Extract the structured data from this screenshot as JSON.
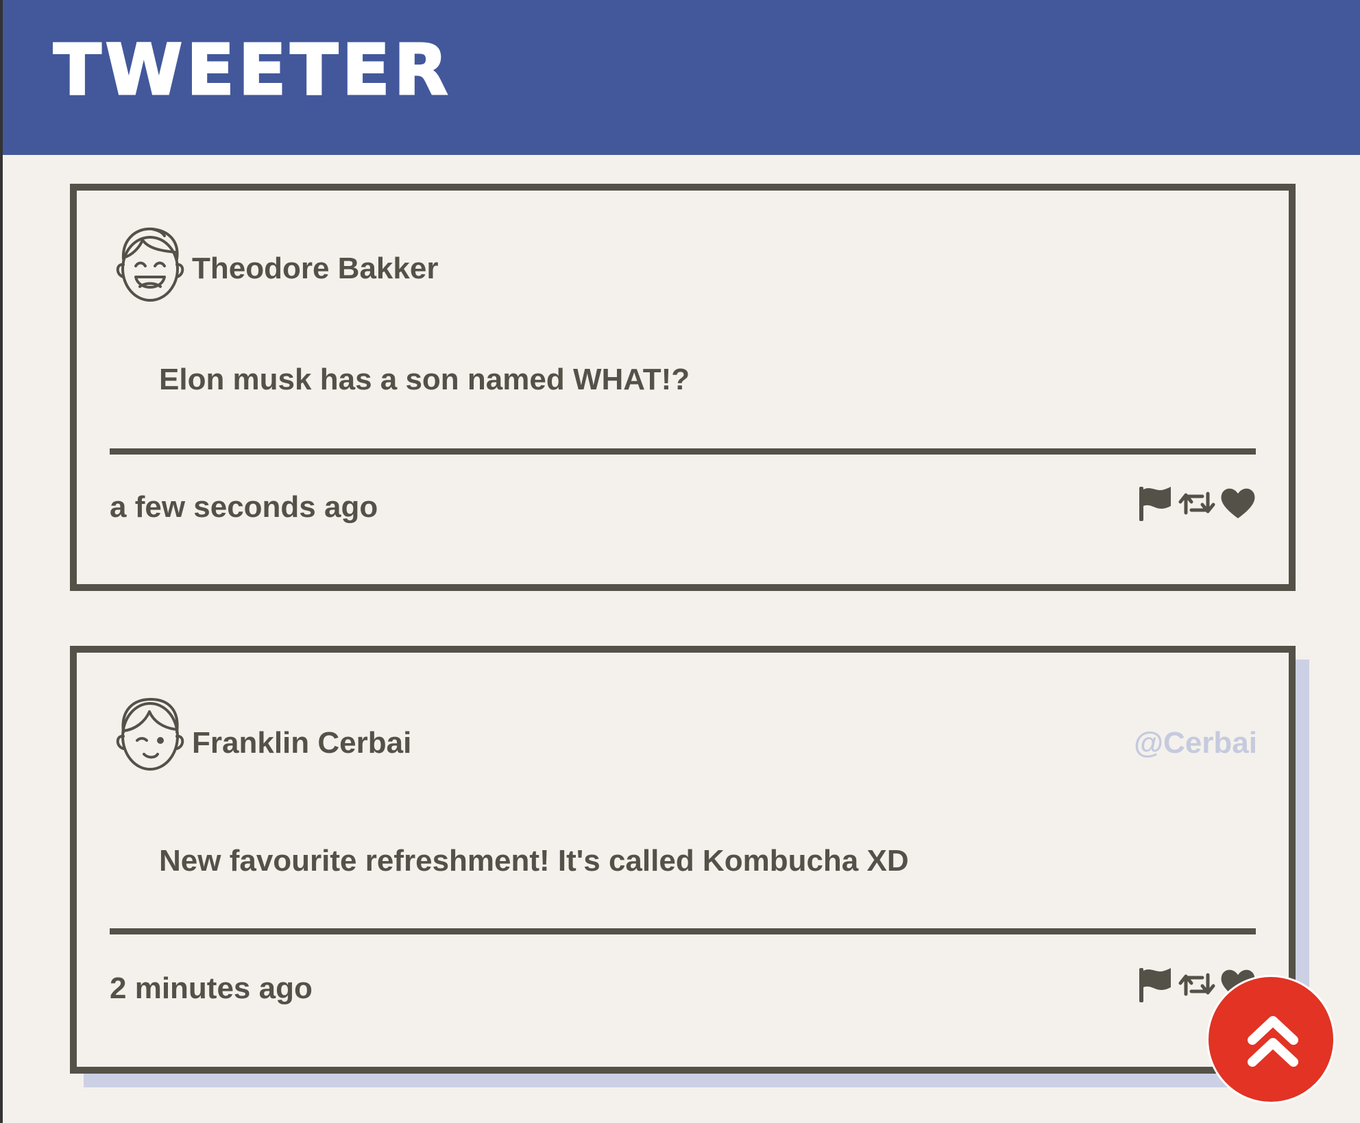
{
  "app": {
    "brand": "TWEETER"
  },
  "tweets": [
    {
      "author": "Theodore Bakker",
      "handle": "",
      "avatar": "laughing-face-icon",
      "content": "Elon musk has a son named WHAT!?",
      "timestamp": "a few seconds ago",
      "actions": [
        "flag-icon",
        "retweet-icon",
        "heart-icon"
      ]
    },
    {
      "author": "Franklin Cerbai",
      "handle": "@Cerbai",
      "avatar": "winking-face-icon",
      "content": "New favourite refreshment! It's called Kombucha XD",
      "timestamp": "2 minutes ago",
      "actions": [
        "flag-icon",
        "retweet-icon",
        "heart-icon"
      ]
    }
  ],
  "scroll_top_button": {
    "icon": "double-chevron-up-icon"
  },
  "colors": {
    "nav": "#43589b",
    "background": "#f4f1ec",
    "text": "#545149",
    "handle": "#c5cade",
    "shadow": "#cbd0e4",
    "scroll_button": "#e23324"
  }
}
